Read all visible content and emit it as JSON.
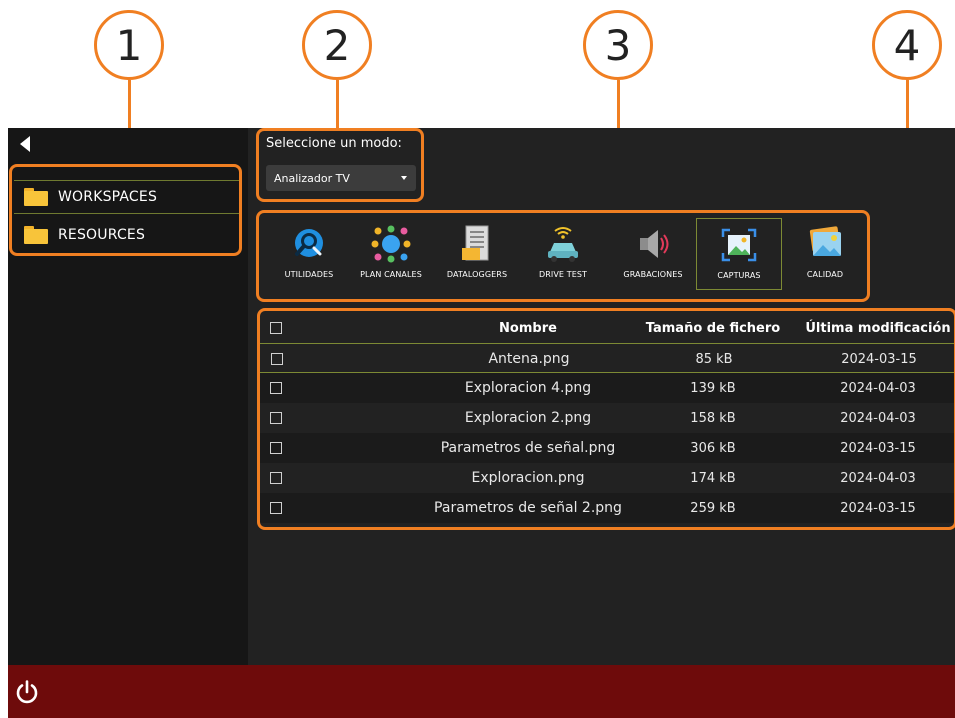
{
  "callouts": [
    "1",
    "2",
    "3",
    "4"
  ],
  "sidebar": {
    "items": [
      {
        "label": "WORKSPACES",
        "icon": "folder-icon"
      },
      {
        "label": "RESOURCES",
        "icon": "folder-icon"
      }
    ]
  },
  "mode": {
    "label": "Seleccione un modo:",
    "selected": "Analizador TV"
  },
  "tools": [
    {
      "label": "UTILIDADES",
      "icon": "wrench-magnifier-icon"
    },
    {
      "label": "PLAN CANALES",
      "icon": "channel-plan-icon"
    },
    {
      "label": "DATALOGGERS",
      "icon": "document-icon"
    },
    {
      "label": "DRIVE TEST",
      "icon": "car-signal-icon"
    },
    {
      "label": "GRABACIONES",
      "icon": "speaker-icon"
    },
    {
      "label": "CAPTURAS",
      "icon": "screenshot-icon",
      "active": true
    },
    {
      "label": "CALIDAD",
      "icon": "image-quality-icon"
    }
  ],
  "table": {
    "headers": {
      "name": "Nombre",
      "size": "Tamaño de fichero",
      "date": "Última modificación"
    },
    "rows": [
      {
        "name": "Antena.png",
        "size": "85 kB",
        "date": "2024-03-15"
      },
      {
        "name": "Exploracion 4.png",
        "size": "139 kB",
        "date": "2024-04-03"
      },
      {
        "name": "Exploracion 2.png",
        "size": "158 kB",
        "date": "2024-04-03"
      },
      {
        "name": "Parametros de señal.png",
        "size": "306 kB",
        "date": "2024-03-15"
      },
      {
        "name": "Exploracion.png",
        "size": "174 kB",
        "date": "2024-04-03"
      },
      {
        "name": "Parametros de señal 2.png",
        "size": "259 kB",
        "date": "2024-03-15"
      }
    ]
  },
  "colors": {
    "accent_orange": "#f07f22",
    "selection_green": "#7d8a34",
    "bottom_bar": "#6e0b0b",
    "folder": "#f8c43a"
  }
}
